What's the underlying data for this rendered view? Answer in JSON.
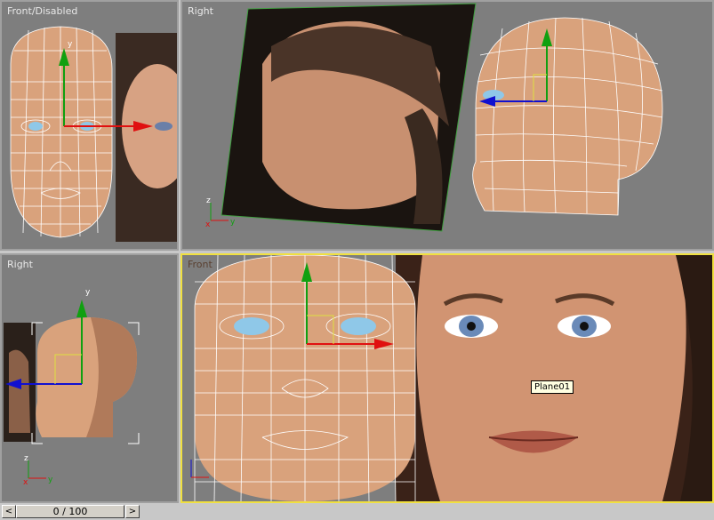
{
  "viewports": {
    "top_left": {
      "label": "Front/Disabled"
    },
    "top_right": {
      "label": "Right"
    },
    "bottom_left": {
      "label": "Right"
    },
    "bottom_right": {
      "label": "Front"
    }
  },
  "tooltip": "Plane01",
  "axis_labels": {
    "x": "x",
    "y": "y",
    "z": "z"
  },
  "timeline": {
    "frame_display": "0 / 100",
    "prev_icon": "chevron-left-icon",
    "next_icon": "chevron-right-icon",
    "prev_glyph": "<",
    "next_glyph": ">"
  },
  "colors": {
    "viewport_bg": "#7e7e7e",
    "active_border": "#f0e040",
    "skin": "#d9a27c",
    "wire": "#ffffff",
    "axis_x": "#e01010",
    "axis_y": "#10a010",
    "axis_z": "#1010d0"
  }
}
